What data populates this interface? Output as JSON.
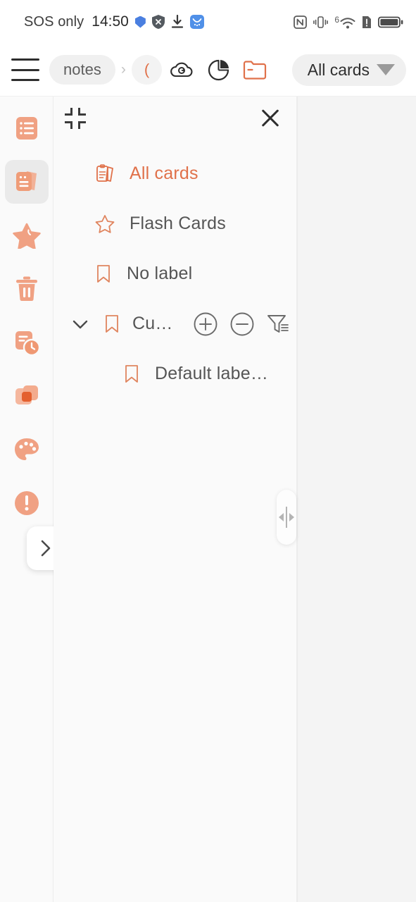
{
  "statusbar": {
    "carrier": "SOS only",
    "time": "14:50",
    "left_icons": [
      "shield-blue-icon",
      "shield-x-icon",
      "download-icon",
      "app-badge-icon"
    ],
    "right_icons": [
      "nfc-icon",
      "vibrate-icon",
      "wifi-6-icon",
      "sim-alert-icon",
      "battery-icon"
    ],
    "wifi_generation": "6"
  },
  "toolbar": {
    "menu_icon": "hamburger-icon",
    "breadcrumb": [
      {
        "label": "notes"
      },
      {
        "label": "("
      }
    ],
    "separator": "›",
    "icons": [
      "cloud-sync-icon",
      "pie-chart-icon",
      "folder-icon"
    ],
    "dropdown_label": "All cards",
    "dropdown_caret": "caret-down-icon"
  },
  "sidebar": {
    "items": [
      {
        "name": "notes-list",
        "icon": "notes-list-icon",
        "selected": false
      },
      {
        "name": "cards",
        "icon": "cards-stack-icon",
        "selected": true
      },
      {
        "name": "favorites",
        "icon": "star-icon",
        "selected": false
      },
      {
        "name": "trash",
        "icon": "trash-icon",
        "selected": false
      },
      {
        "name": "recent",
        "icon": "recent-clock-icon",
        "selected": false
      },
      {
        "name": "layers",
        "icon": "layers-icon",
        "selected": false
      },
      {
        "name": "themes",
        "icon": "palette-icon",
        "selected": false
      },
      {
        "name": "alerts",
        "icon": "alert-circle-icon",
        "selected": false
      }
    ],
    "expand_button_icon": "chevron-right-icon"
  },
  "panel": {
    "collapse_icon": "collapse-icon",
    "close_icon": "close-icon",
    "items": [
      {
        "label": "All cards",
        "icon": "clipboard-cards-icon",
        "active": true,
        "nested": false,
        "group": false,
        "actions": []
      },
      {
        "label": "Flash Cards",
        "icon": "star-outline-icon",
        "active": false,
        "nested": false,
        "group": false,
        "actions": []
      },
      {
        "label": "No label",
        "icon": "bookmark-icon",
        "active": false,
        "nested": false,
        "group": false,
        "actions": []
      },
      {
        "label": "Cu…",
        "icon": "bookmark-icon",
        "active": false,
        "nested": false,
        "group": true,
        "actions": [
          "plus-circle-icon",
          "minus-circle-icon",
          "filter-icon"
        ]
      },
      {
        "label": "Default labe…",
        "icon": "bookmark-icon",
        "active": false,
        "nested": true,
        "group": false,
        "actions": []
      }
    ],
    "expander_icon": "chevron-down-icon"
  },
  "resize_handle": {
    "icon": "resize-horizontal-icon"
  },
  "colors": {
    "accent": "#e0714a",
    "accent_soft": "#f0a183",
    "text": "#555555",
    "panel_bg": "#fafafa",
    "content_bg": "#f4f4f4",
    "selected_bg": "#eaeaea",
    "chip_bg": "#f0f0f0"
  }
}
